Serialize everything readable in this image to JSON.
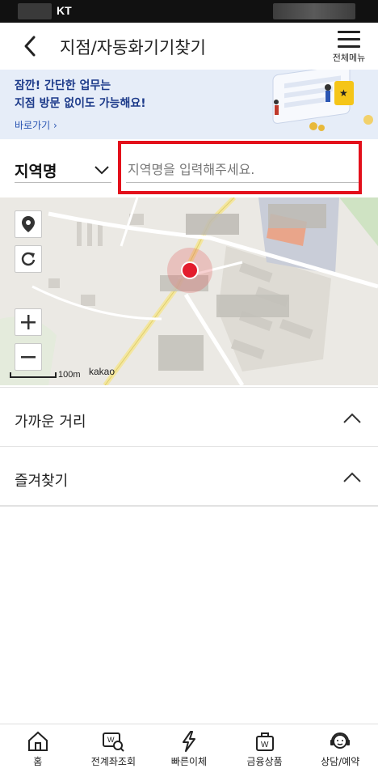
{
  "statusbar": {
    "carrier": "KT"
  },
  "header": {
    "title": "지점/자동화기기찾기",
    "menu_label": "전체메뉴"
  },
  "banner": {
    "line1": "잠깐! 간단한 업무는",
    "line2": "지점 방문 없이도 가능해요!",
    "link": "바로가기 ›"
  },
  "search": {
    "region_label": "지역명",
    "placeholder": "지역명을 입력해주세요."
  },
  "map": {
    "scale_label": "100m",
    "provider": "kakao"
  },
  "sections": [
    {
      "label": "가까운 거리"
    },
    {
      "label": "즐겨찾기"
    }
  ],
  "bottom_nav": [
    {
      "label": "홈",
      "icon": "home-icon"
    },
    {
      "label": "전계좌조회",
      "icon": "account-search-icon"
    },
    {
      "label": "빠른이체",
      "icon": "lightning-icon"
    },
    {
      "label": "금융상품",
      "icon": "bag-icon"
    },
    {
      "label": "상담/예약",
      "icon": "headset-icon"
    }
  ]
}
